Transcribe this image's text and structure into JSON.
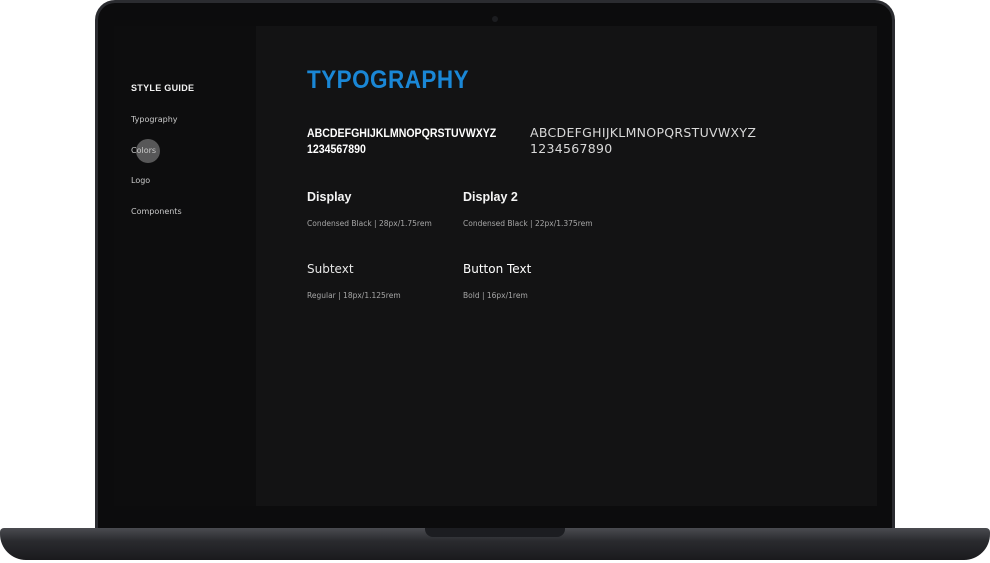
{
  "sidebar": {
    "heading": "STYLE GUIDE",
    "items": [
      {
        "label": "Typography"
      },
      {
        "label": "Colors"
      },
      {
        "label": "Logo"
      },
      {
        "label": "Components"
      }
    ]
  },
  "main": {
    "title": "TYPOGRAPHY",
    "samples": {
      "bold_line1": "ABCDEFGHIJKLMNOPQRSTUVWXYZ",
      "bold_line2": "1234567890",
      "light_line1": "ABCDEFGHIJKLMNOPQRSTUVWXYZ",
      "light_line2": "1234567890"
    },
    "specs": [
      {
        "name": "Display",
        "detail": "Condensed Black | 28px/1.75rem"
      },
      {
        "name": "Display 2",
        "detail": "Condensed Black | 22px/1.375rem"
      },
      {
        "name": "Subtext",
        "detail": "Regular | 18px/1.125rem"
      },
      {
        "name": "Button Text",
        "detail": "Bold | 16px/1rem"
      }
    ]
  },
  "colors": {
    "accent": "#1a87d6",
    "screen_bg": "#131314",
    "sidebar_bg": "#0d0d0e",
    "bezel": "#2b2c30"
  }
}
